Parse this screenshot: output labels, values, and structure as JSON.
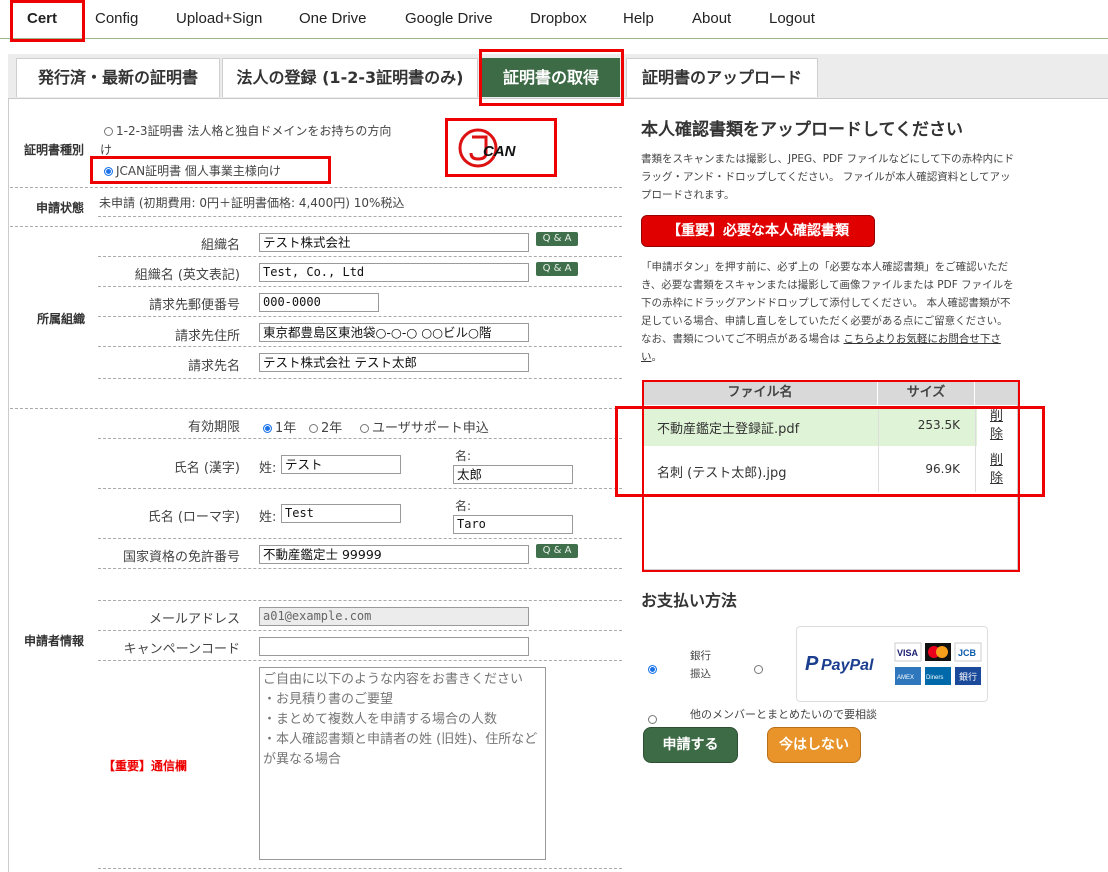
{
  "nav": {
    "items": [
      "Cert",
      "Config",
      "Upload+Sign",
      "One Drive",
      "Google Drive",
      "Dropbox",
      "Help",
      "About",
      "Logout"
    ]
  },
  "tabs": [
    "発行済・最新の証明書",
    "法人の登録 (1-2-3証明書のみ)",
    "証明書の取得",
    "証明書のアップロード"
  ],
  "left": {
    "cert_type_label": "証明書種別",
    "cert_opt1_line1": "1-2-3証明書 法人格と独自ドメインをお持ちの方向",
    "cert_opt1_line2": "け",
    "cert_opt2": "JCAN証明書 個人事業主様向け",
    "status_label": "申請状態",
    "status_value": "未申請 (初期費用: 0円＋証明書価格: 4,400円) 10%税込",
    "org_section": "所属組織",
    "org_name_label": "組織名",
    "org_name_value": "テスト株式会社",
    "org_name_en_label": "組織名 (英文表記)",
    "org_name_en_value": "Test, Co., Ltd",
    "zip_label": "請求先郵便番号",
    "zip_value": "000-0000",
    "addr_label": "請求先住所",
    "addr_value": "東京都豊島区東池袋○-○-○ ○○ビル○階",
    "billto_label": "請求先名",
    "billto_value": "テスト株式会社 テスト太郎",
    "qa_label": "Q & A",
    "validity_label": "有効期限",
    "validity_opts": [
      "1年",
      "2年",
      "ユーザサポート申込"
    ],
    "name_kanji_label": "氏名 (漢字)",
    "sei_label": "姓:",
    "mei_label": "名:",
    "sei_kanji": "テスト",
    "mei_kanji": "太郎",
    "name_roman_label": "氏名 (ローマ字)",
    "sei_roman": "Test",
    "mei_roman": "Taro",
    "license_label": "国家資格の免許番号",
    "license_value": "不動産鑑定士 99999",
    "applicant_section": "申請者情報",
    "email_label": "メールアドレス",
    "email_value": "a01@example.com",
    "campaign_label": "キャンペーンコード",
    "campaign_value": "",
    "notes_label": "【重要】通信欄",
    "notes_placeholder": "ご自由に以下のような内容をお書きください\n・お見積り書のご要望\n・まとめて複数人を申請する場合の人数\n・本人確認書類と申請者の姓 (旧姓)、住所などが異なる場合"
  },
  "right": {
    "upload_title": "本人確認書類をアップロードしてください",
    "upload_desc": "書類をスキャンまたは撮影し、JPEG、PDF ファイルなどにして下の赤枠内にドラッグ・アンド・ドロップしてください。 ファイルが本人確認資料としてアップロードされます。",
    "required_docs_button": "【重要】必要な本人確認書類",
    "notice": "「申請ボタン」を押す前に、必ず上の「必要な本人確認書類」をご確認いただき、必要な書類をスキャンまたは撮影して画像ファイルまたは PDF ファイルを下の赤枠にドラッグアンドドロップして添付してください。 本人確認書類が不足している場合、申請し直しをしていただく必要がある点にご留意ください。 なお、書類についてご不明点がある場合は",
    "notice_link": "こちらよりお気軽にお問合せ下さい",
    "notice_end": "。",
    "col_filename": "ファイル名",
    "col_size": "サイズ",
    "files": [
      {
        "name": "不動産鑑定士登録証.pdf",
        "size": "253.5K",
        "delete": "削除"
      },
      {
        "name": "名刺 (テスト太郎).jpg",
        "size": "96.9K",
        "delete": "削除"
      }
    ],
    "payment_title": "お支払い方法",
    "bank_transfer": "銀行振込",
    "paypal": "PayPal",
    "card_brands": [
      "VISA",
      "mc",
      "JCB",
      "AMEX",
      "Diners",
      "銀行"
    ],
    "consult_option": "他のメンバーとまとめたいので要相談",
    "apply_button": "申請する",
    "later_button": "今はしない",
    "logo_text": "JCAN"
  },
  "colors": {
    "accent_green": "#3d6b45",
    "highlight_red": "#e00000",
    "row_highlight": "#dff3d6",
    "later_orange": "#e8942a"
  }
}
